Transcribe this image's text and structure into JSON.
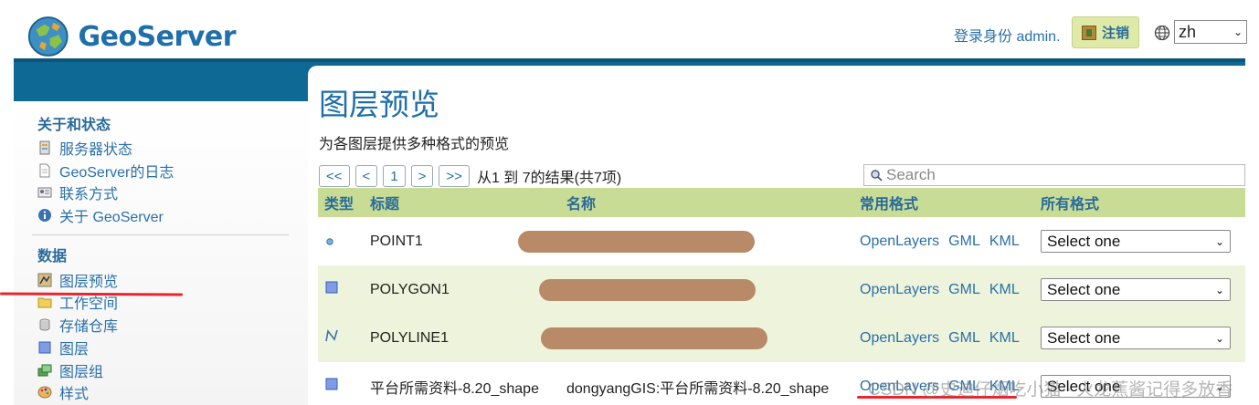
{
  "header": {
    "logo_text": "GeoServer",
    "login_text": "登录身份 admin.",
    "logout_label": "注销",
    "language": "zh"
  },
  "sidebar": {
    "sections": [
      {
        "heading": "关于和状态",
        "items": [
          {
            "label": "服务器状态",
            "icon": "server-status-icon"
          },
          {
            "label": "GeoServer的日志",
            "icon": "log-file-icon"
          },
          {
            "label": "联系方式",
            "icon": "contact-card-icon"
          },
          {
            "label": "关于 GeoServer",
            "icon": "info-icon"
          }
        ]
      },
      {
        "heading": "数据",
        "items": [
          {
            "label": "图层预览",
            "icon": "layer-preview-icon"
          },
          {
            "label": "工作空间",
            "icon": "folder-icon"
          },
          {
            "label": "存储仓库",
            "icon": "database-icon"
          },
          {
            "label": "图层",
            "icon": "layer-icon"
          },
          {
            "label": "图层组",
            "icon": "layer-group-icon"
          },
          {
            "label": "样式",
            "icon": "palette-icon"
          }
        ]
      }
    ]
  },
  "main": {
    "title": "图层预览",
    "description": "为各图层提供多种格式的预览",
    "pager": {
      "first": "<<",
      "prev": "<",
      "current": "1",
      "next": ">",
      "last": ">>",
      "summary": "从1 到 7的结果(共7项)"
    },
    "search_placeholder": "Search",
    "table": {
      "headers": {
        "type": "类型",
        "title": "标题",
        "name": "名称",
        "common": "常用格式",
        "all": "所有格式"
      },
      "rows": [
        {
          "type_icon": "point-icon",
          "title": "POINT1",
          "name": "",
          "formats": [
            "OpenLayers",
            "GML",
            "KML"
          ],
          "select": "Select one"
        },
        {
          "type_icon": "polygon-icon",
          "title": "POLYGON1",
          "name": "",
          "formats": [
            "OpenLayers",
            "GML",
            "KML"
          ],
          "select": "Select one"
        },
        {
          "type_icon": "polyline-icon",
          "title": "POLYLINE1",
          "name": "",
          "formats": [
            "OpenLayers",
            "GML",
            "KML"
          ],
          "select": "Select one"
        },
        {
          "type_icon": "polygon-icon",
          "title": "平台所需资料-8.20_shape",
          "name": "dongyangGIS:平台所需资料-8.20_shape",
          "formats": [
            "OpenLayers",
            "GML",
            "KML"
          ],
          "select": "Select one"
        }
      ]
    }
  },
  "watermark": "CSDN @史迪仔烟吃小猫 · 火龙蕉酱记得多放香",
  "colors": {
    "brand_blue": "#1f6fa8",
    "band_blue": "#0e6a94",
    "header_row": "#c8dc95",
    "alt_row": "#eef4dc",
    "annotation_red": "#e8262e"
  }
}
